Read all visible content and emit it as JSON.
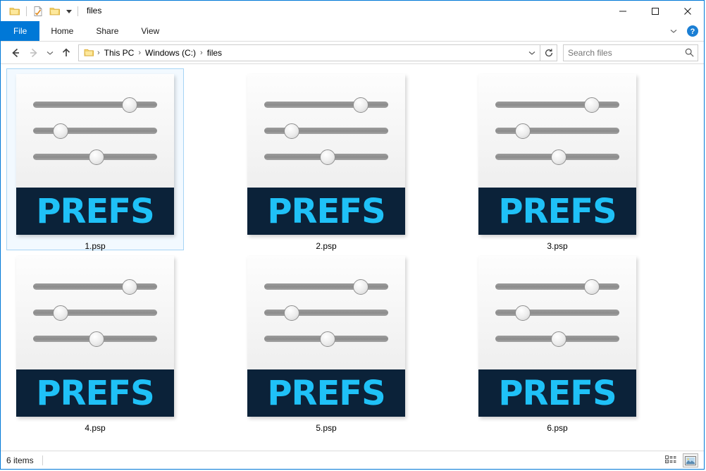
{
  "window": {
    "title": "files",
    "quick_access": [
      {
        "name": "folder-icon",
        "label": "Folder"
      },
      {
        "name": "properties-icon",
        "label": "Properties"
      },
      {
        "name": "new-folder-icon",
        "label": "New folder"
      },
      {
        "name": "customize-quick-access-icon",
        "label": "Customize Quick Access Toolbar"
      }
    ],
    "controls": {
      "minimize": "—",
      "maximize": "☐",
      "close": "✕"
    }
  },
  "ribbon": {
    "tabs": [
      {
        "label": "File",
        "active": true
      },
      {
        "label": "Home",
        "active": false
      },
      {
        "label": "Share",
        "active": false
      },
      {
        "label": "View",
        "active": false
      }
    ],
    "expand_label": "⌄",
    "help_label": "?"
  },
  "address": {
    "back_label": "←",
    "forward_label": "→",
    "recent_label": "⌄",
    "up_label": "↑",
    "separator": "›",
    "crumbs": [
      "This PC",
      "Windows (C:)",
      "files"
    ],
    "dropdown_label": "⌄",
    "refresh_label": "↻"
  },
  "search": {
    "placeholder": "Search files",
    "value": "",
    "icon": "search-icon"
  },
  "files": [
    {
      "name": "1.psp",
      "banner": "PREFS",
      "selected": true
    },
    {
      "name": "2.psp",
      "banner": "PREFS",
      "selected": false
    },
    {
      "name": "3.psp",
      "banner": "PREFS",
      "selected": false
    },
    {
      "name": "4.psp",
      "banner": "PREFS",
      "selected": false
    },
    {
      "name": "5.psp",
      "banner": "PREFS",
      "selected": false
    },
    {
      "name": "6.psp",
      "banner": "PREFS",
      "selected": false
    }
  ],
  "icon_art": {
    "sliders": [
      {
        "knob_percent": 78
      },
      {
        "knob_percent": 22
      },
      {
        "knob_percent": 51
      }
    ],
    "banner_color": "#0b2239",
    "banner_text_color": "#1fc1f7"
  },
  "status": {
    "items_text": "6 items",
    "views": [
      {
        "name": "details-view",
        "active": false
      },
      {
        "name": "large-icons-view",
        "active": true
      }
    ]
  },
  "colors": {
    "accent": "#0078d7",
    "selection_border": "#a6d4f5",
    "selection_fill": "#f2f9ff"
  }
}
